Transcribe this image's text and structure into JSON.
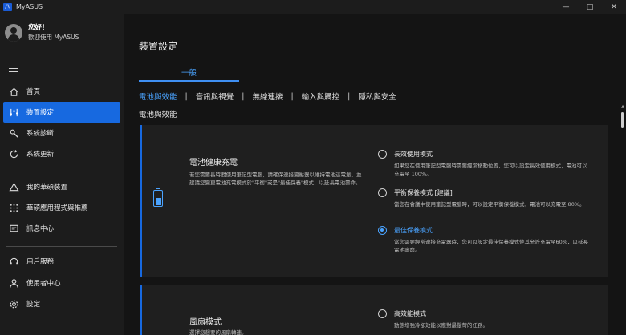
{
  "window": {
    "title": "MyASUS",
    "logo_text": "/∖"
  },
  "user": {
    "greeting": "您好！",
    "welcome": "歡迎使用 MyASUS"
  },
  "sidebar": {
    "items": [
      {
        "label": "首頁",
        "icon": "home-icon"
      },
      {
        "label": "裝置設定",
        "icon": "sliders-icon",
        "active": true
      },
      {
        "label": "系統診斷",
        "icon": "wrench-icon"
      },
      {
        "label": "系統更新",
        "icon": "refresh-icon"
      },
      {
        "label": "我的華碩裝置",
        "icon": "triangle-icon"
      },
      {
        "label": "華碩應用程式與推薦",
        "icon": "grid-icon"
      },
      {
        "label": "訊息中心",
        "icon": "message-icon"
      },
      {
        "label": "用戶服務",
        "icon": "headset-icon"
      },
      {
        "label": "使用者中心",
        "icon": "user-icon"
      },
      {
        "label": "設定",
        "icon": "gear-icon"
      }
    ]
  },
  "main": {
    "page_title": "裝置設定",
    "top_tab": "一般",
    "subtabs": [
      "電池與效能",
      "音訊與視覺",
      "無線連接",
      "輸入與觸控",
      "隱私與安全"
    ],
    "section_label": "電池與效能",
    "battery_card": {
      "title": "電池健康充電",
      "description": "若您需要長時間使用筆記型電腦，請確保連接變壓器以維持電池這電量，並建議您變更電池充電模式於\"平衡\"或是\"最佳保養\"模式，以延長電池壽命。",
      "options": [
        {
          "title": "長效使用模式",
          "desc": "如果您在使用筆記型電腦時需要經常移動位置，您可以設定長效使用模式，電池可以充電至 100%。",
          "selected": false
        },
        {
          "title": "平衡保養模式 [建議]",
          "desc": "當您在會議中使用筆記型電腦時，可以設定平衡保養模式，電池可以充電至 80%。",
          "selected": false
        },
        {
          "title": "最佳保養模式",
          "desc": "當您需要經常連接充電器時，您可以設定最佳保養模式使其允許充電至60%，以延長電池壽命。",
          "selected": true
        }
      ]
    },
    "fan_card": {
      "title": "風扇模式",
      "description": "選擇您想要的風扇轉速。",
      "options": [
        {
          "title": "高效能模式",
          "desc": "動態增強冷卻效能以應對最嚴苛的任務。",
          "selected": false
        }
      ]
    }
  },
  "colors": {
    "accent": "#1769e0",
    "accent_text": "#4aa3ff",
    "sidebar_bg": "#1c1c1c",
    "card_bg": "#1f1f1f"
  }
}
